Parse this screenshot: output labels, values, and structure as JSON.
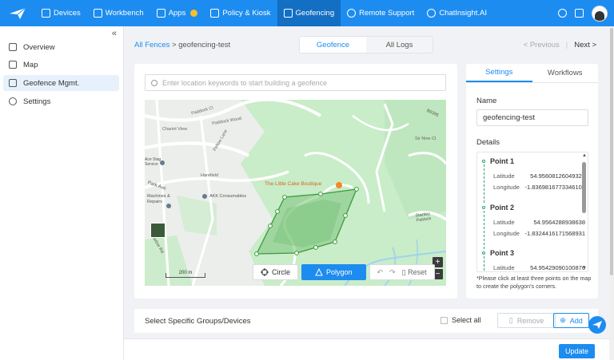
{
  "nav": {
    "items": [
      {
        "label": "Devices",
        "icon": "devices-icon"
      },
      {
        "label": "Workbench",
        "icon": "workbench-icon"
      },
      {
        "label": "Apps",
        "icon": "apps-icon"
      },
      {
        "label": "Policy & Kiosk",
        "icon": "policy-icon"
      },
      {
        "label": "Geofencing",
        "icon": "geofence-icon",
        "active": true
      },
      {
        "label": "Remote Support",
        "icon": "remote-support-icon"
      },
      {
        "label": "ChatInsight.AI",
        "icon": "chat-icon"
      }
    ],
    "accent": "#1d8cf0"
  },
  "sidebar": {
    "items": [
      {
        "label": "Overview",
        "icon": "overview-icon"
      },
      {
        "label": "Map",
        "icon": "map-icon"
      },
      {
        "label": "Geofence Mgmt.",
        "icon": "geofence-mgmt-icon",
        "active": true
      },
      {
        "label": "Settings",
        "icon": "gear-icon"
      }
    ]
  },
  "breadcrumb": {
    "root": "All Fences",
    "separator": ">",
    "current": "geofencing-test"
  },
  "tabs": {
    "geofence": "Geofence",
    "logs": "All Logs"
  },
  "pager": {
    "previous": "< Previous",
    "separator": "|",
    "next": "Next >"
  },
  "search": {
    "placeholder": "Enter location keywords to start building a geofence"
  },
  "map": {
    "place_label": "The Little Cake Boutique",
    "labels": [
      "Paddock Wood",
      "Paddock Cl",
      "Chariot View",
      "Pellow Lane",
      "Sir Nine Cl",
      "Harefield",
      "Park Ave",
      "Machines & Repairs",
      "AKK Consumables",
      "Ace Stag Service",
      "Stanley Pasture",
      "Harbor Rd",
      "B6395"
    ],
    "scale_label": "200 m",
    "zoom_in": "+",
    "zoom_out": "−"
  },
  "toolbar": {
    "circle": "Circle",
    "polygon": "Polygon",
    "reset": "Reset"
  },
  "settings": {
    "tabs": {
      "settings": "Settings",
      "workflows": "Workflows"
    },
    "name_label": "Name",
    "name_value": "geofencing-test",
    "details_label": "Details",
    "lat_label": "Latitude",
    "lng_label": "Longitude",
    "points": [
      {
        "name": "Point 1",
        "lat": "54.95608126049322",
        "lng": "-1.8369816773346106"
      },
      {
        "name": "Point 2",
        "lat": "54.9564288938638",
        "lng": "-1.8324416171568931"
      },
      {
        "name": "Point 3",
        "lat": "54.95429090100876",
        "lng": ""
      }
    ],
    "hint": "*Please click at least three points on the map to create the polygon's corners."
  },
  "groups": {
    "title": "Select Specific Groups/Devices",
    "select_all": "Select all",
    "remove": "Remove",
    "add": "Add"
  },
  "footer": {
    "update": "Update"
  }
}
